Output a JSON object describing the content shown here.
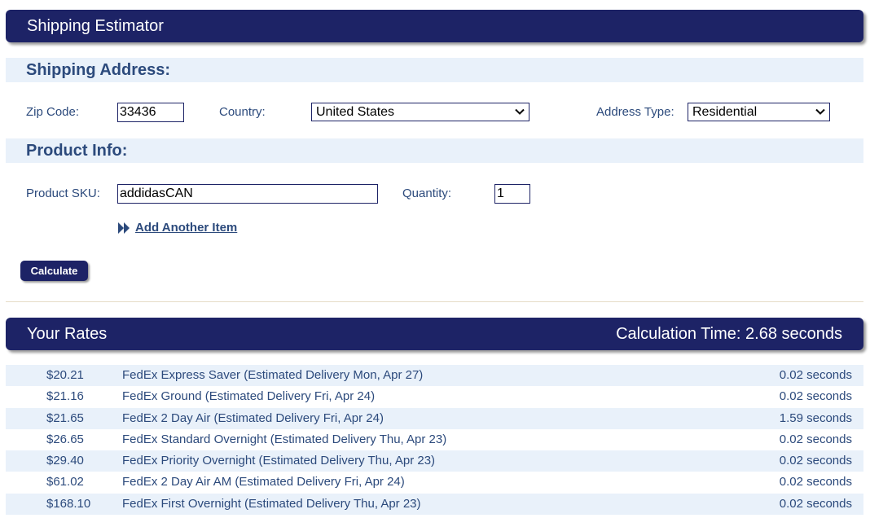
{
  "header": {
    "title": "Shipping Estimator"
  },
  "address": {
    "heading": "Shipping Address:",
    "zip_label": "Zip Code:",
    "zip_value": "33436",
    "country_label": "Country:",
    "country_value": "United States",
    "address_type_label": "Address Type:",
    "address_type_value": "Residential"
  },
  "product": {
    "heading": "Product Info:",
    "sku_label": "Product SKU:",
    "sku_value": "addidasCAN",
    "quantity_label": "Quantity:",
    "quantity_value": "1",
    "add_item_label": "Add Another Item"
  },
  "calculate_label": "Calculate",
  "rates": {
    "title": "Your Rates",
    "calc_time": "Calculation Time: 2.68 seconds",
    "rows": [
      {
        "price": "$20.21",
        "service": "FedEx Express Saver (Estimated Delivery Mon, Apr 27)",
        "time": "0.02 seconds"
      },
      {
        "price": "$21.16",
        "service": "FedEx Ground (Estimated Delivery Fri, Apr 24)",
        "time": "0.02 seconds"
      },
      {
        "price": "$21.65",
        "service": "FedEx 2 Day Air (Estimated Delivery Fri, Apr 24)",
        "time": "1.59 seconds"
      },
      {
        "price": "$26.65",
        "service": "FedEx Standard Overnight (Estimated Delivery Thu, Apr 23)",
        "time": "0.02 seconds"
      },
      {
        "price": "$29.40",
        "service": "FedEx Priority Overnight (Estimated Delivery Thu, Apr 23)",
        "time": "0.02 seconds"
      },
      {
        "price": "$61.02",
        "service": "FedEx 2 Day Air AM (Estimated Delivery Fri, Apr 24)",
        "time": "0.02 seconds"
      },
      {
        "price": "$168.10",
        "service": "FedEx First Overnight (Estimated Delivery Thu, Apr 23)",
        "time": "0.02 seconds"
      }
    ]
  },
  "colors": {
    "header_bg": "#1d2366",
    "section_bg": "#e9f1fa",
    "text": "#2c4a7c"
  },
  "icons": {
    "select_arrow": "chevron-down-icon",
    "add_item": "double-chevron-right-icon"
  }
}
